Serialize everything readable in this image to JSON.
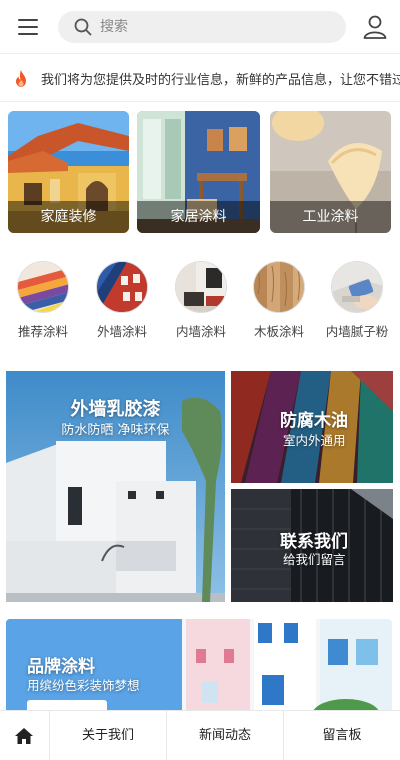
{
  "header": {
    "search_placeholder": "搜索"
  },
  "notice": {
    "text": "我们将为您提供及时的行业信息，新鲜的产品信息，让您不错过"
  },
  "cards": [
    {
      "label": "家庭装修"
    },
    {
      "label": "家居涂料"
    },
    {
      "label": "工业涂料"
    }
  ],
  "categories": [
    {
      "label": "推荐涂料"
    },
    {
      "label": "外墙涂料"
    },
    {
      "label": "内墙涂料"
    },
    {
      "label": "木板涂料"
    },
    {
      "label": "内墙腻子粉"
    }
  ],
  "features": {
    "latex": {
      "title": "外墙乳胶漆",
      "subtitle": "防水防晒 净味环保"
    },
    "wood": {
      "title": "防腐木油",
      "subtitle": "室内外通用"
    },
    "contact": {
      "title": "联系我们",
      "subtitle": "给我们留言"
    },
    "brand": {
      "title": "品牌涂料",
      "subtitle": "用缤纷色彩装饰梦想"
    }
  },
  "bottom_nav": {
    "about": "关于我们",
    "news": "新闻动态",
    "guestbook": "留言板"
  },
  "colors": {
    "icon": "#444444",
    "fire": "#f05a28",
    "card_label_bg": "rgba(0,0,0,0.45)",
    "home_icon": "#222222"
  },
  "icons": [
    "menu-icon",
    "search-icon",
    "user-icon",
    "fire-icon",
    "home-icon"
  ]
}
